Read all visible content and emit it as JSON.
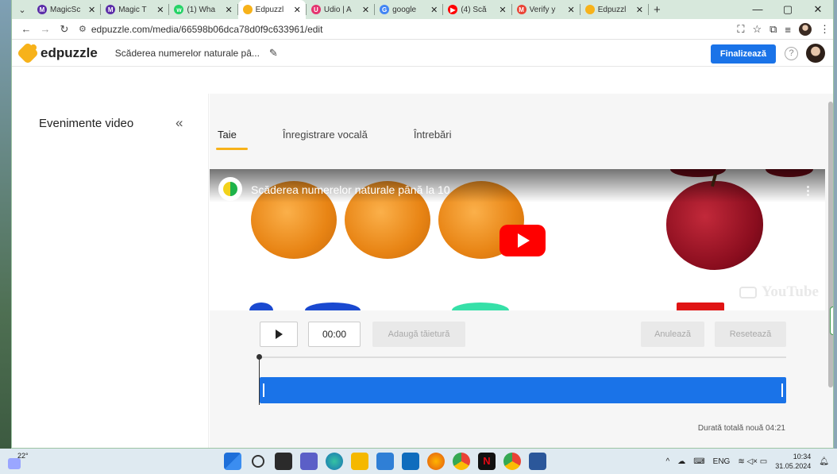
{
  "browser": {
    "tabs": [
      {
        "label": "MagicSc",
        "color": "#5b2da8",
        "glyph": "M"
      },
      {
        "label": "Magic T",
        "color": "#5b2da8",
        "glyph": "M"
      },
      {
        "label": "(1) Wha",
        "color": "#25d366",
        "glyph": "w"
      },
      {
        "label": "Edpuzzl",
        "color": "#f7b21a",
        "glyph": "",
        "active": true
      },
      {
        "label": "Udio | A",
        "color": "#e5336f",
        "glyph": "U"
      },
      {
        "label": "google",
        "color": "#4285f4",
        "glyph": "G"
      },
      {
        "label": "(4) Scă",
        "color": "#ff0000",
        "glyph": "▶"
      },
      {
        "label": "Verify y",
        "color": "#ea4335",
        "glyph": "M"
      },
      {
        "label": "Edpuzzl",
        "color": "#f7b21a",
        "glyph": ""
      }
    ],
    "new_tab": "+",
    "url": "edpuzzle.com/media/66598b06dca78d0f9c633961/edit"
  },
  "app": {
    "logo_text": "edpuzzle",
    "video_title": "Scăderea numerelor naturale pâ...",
    "finalize_label": "Finalizează",
    "help": "?"
  },
  "sidebar": {
    "title": "Evenimente video",
    "collapse": "«"
  },
  "tabs": {
    "cut": "Taie",
    "voiceover": "Înregistrare vocală",
    "questions": "Întrebări"
  },
  "video": {
    "title": "Scăderea numerelor naturale până la 10",
    "watermark": "YouTube"
  },
  "editor": {
    "time": "00:00",
    "add_cut": "Adaugă tăietură",
    "cancel": "Anulează",
    "reset": "Resetează",
    "total": "Durată totală nouă 04:21"
  },
  "taskbar": {
    "temperature": "22°",
    "language": "ENG",
    "time": "10:34",
    "date": "31.05.2024"
  }
}
